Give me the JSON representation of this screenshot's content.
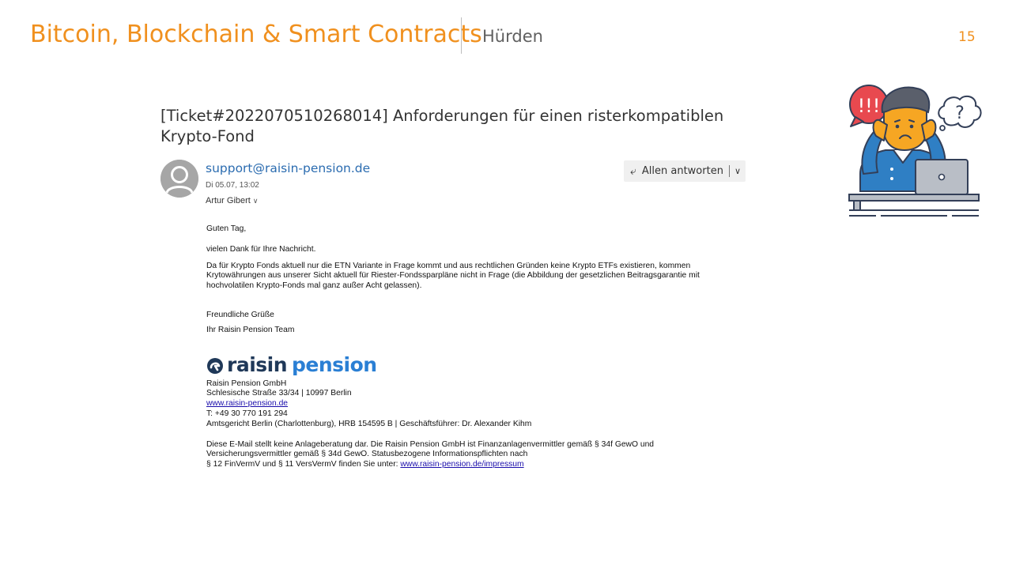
{
  "slide": {
    "title": "Bitcoin, Blockchain & Smart Contracts",
    "subtitle": "Hürden",
    "page_number": "15"
  },
  "email": {
    "subject": "[Ticket#2022070510268014] Anforderungen für einen risterkompatiblen Krypto-Fond",
    "sender": "support@raisin-pension.de",
    "date": "Di 05.07, 13:02",
    "recipient": "Artur Gibert",
    "recipient_expand_icon": "double-chevron-down-icon",
    "reply_all_label": "Allen antworten",
    "reply_icon": "reply-all-icon",
    "more_icon": "chevron-down-icon",
    "body": {
      "greeting": "Guten Tag,",
      "thanks": "vielen Dank für Ihre Nachricht.",
      "main": "Da für Krypto Fonds aktuell nur die ETN Variante in Frage kommt und aus rechtlichen Gründen keine Krypto ETFs existieren, kommen Krytowährungen aus unserer Sicht aktuell für Riester-Fondssparpläne nicht in Frage (die Abbildung der gesetzlichen Beitragsgarantie mit hochvolatilen Krypto-Fonds mal ganz außer Acht gelassen).",
      "closing": "Freundliche Grüße",
      "team": "Ihr Raisin Pension Team"
    },
    "signature": {
      "logo_word1": "raisin",
      "logo_word2": "pension",
      "company": "Raisin Pension GmbH",
      "address": "Schlesische Straße 33/34 | 10997 Berlin",
      "website": "www.raisin-pension.de",
      "phone": "T: +49 30 770 191 294",
      "register": "Amtsgericht Berlin (Charlottenburg), HRB 154595 B | Geschäftsführer: Dr. Alexander Kihm",
      "disclaimer_line1": "Diese E-Mail stellt keine Anlageberatung dar. Die Raisin Pension GmbH ist Finanzanlagenvermittler gemäß § 34f GewO und",
      "disclaimer_line2": "Versicherungsvermittler gemäß § 34d GewO. Statusbezogene Informationspflichten nach",
      "disclaimer_line3_prefix": "§ 12 FinVermV und § 11 VersVermV finden Sie unter: ",
      "impressum_link": "www.raisin-pension.de/impressum"
    }
  },
  "illustration": {
    "icon": "confused-person-at-laptop-icon",
    "bubble_left_text": "!!!",
    "bubble_right_text": "?"
  },
  "colors": {
    "accent": "#F0901E",
    "link": "#2b6cb0",
    "logo_dark": "#1f3858",
    "logo_blue": "#2a7fd4"
  }
}
